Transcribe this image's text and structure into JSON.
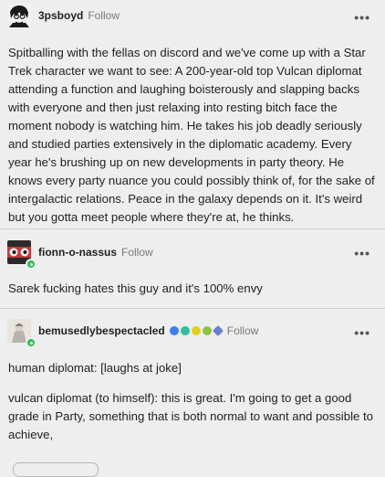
{
  "posts": [
    {
      "username": "3psboyd",
      "follow_label": "Follow",
      "menu_icon": "more-icon",
      "text": "Spitballing with the fellas on discord and we've come up with a Star Trek character we want to see: A 200-year-old top Vulcan diplomat attending a function and laughing boisterously and slapping backs with everyone and then just relaxing into resting bitch face the moment nobody is watching him. He takes his job deadly seriously and studied parties extensively in the diplomatic academy. Every year he's brushing up on new developments in party theory. He knows every party nuance you could possibly think of, for the sake of intergalactic relations. Peace in the galaxy depends on it. It's weird but you gotta meet people where they're at, he thinks."
    },
    {
      "username": "fionn-o-nassus",
      "follow_label": "Follow",
      "menu_icon": "more-icon",
      "text": "Sarek fucking hates this guy and it's 100% envy"
    },
    {
      "username": "bemusedlybespectacled",
      "follow_label": "Follow",
      "menu_icon": "more-icon",
      "badge_colors": [
        "#3d7ef0",
        "#2cbf9c",
        "#e1d020",
        "#8bc34a",
        "#6b7fd0"
      ],
      "text_1": "human diplomat: [laughs at joke]",
      "text_2": "vulcan diplomat (to himself): this is great. I'm going to get a good grade in Party, something that is both normal to want and possible to achieve,"
    }
  ],
  "colors": {
    "background": "#eeeeee",
    "divider": "#cfcfcf",
    "follow_text": "#7a7a7a",
    "online_dot": "#2cbf57"
  }
}
